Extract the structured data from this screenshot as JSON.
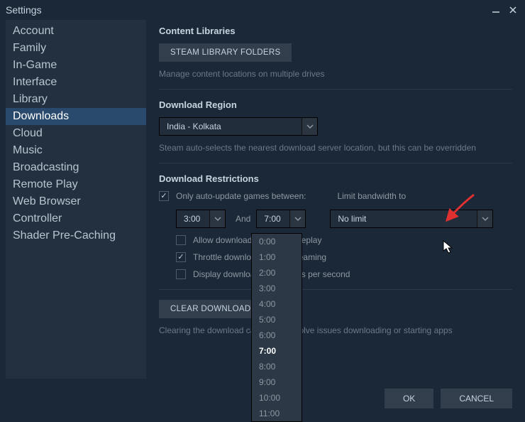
{
  "window": {
    "title": "Settings"
  },
  "sidebar": {
    "items": [
      {
        "label": "Account"
      },
      {
        "label": "Family"
      },
      {
        "label": "In-Game"
      },
      {
        "label": "Interface"
      },
      {
        "label": "Library"
      },
      {
        "label": "Downloads"
      },
      {
        "label": "Cloud"
      },
      {
        "label": "Music"
      },
      {
        "label": "Broadcasting"
      },
      {
        "label": "Remote Play"
      },
      {
        "label": "Web Browser"
      },
      {
        "label": "Controller"
      },
      {
        "label": "Shader Pre-Caching"
      }
    ],
    "active_index": 5
  },
  "content": {
    "libraries": {
      "title": "Content Libraries",
      "button": "STEAM LIBRARY FOLDERS",
      "hint": "Manage content locations on multiple drives"
    },
    "region": {
      "title": "Download Region",
      "value": "India - Kolkata",
      "hint": "Steam auto-selects the nearest download server location, but this can be overridden"
    },
    "restrictions": {
      "title": "Download Restrictions",
      "auto_update": {
        "checked": true,
        "label": "Only auto-update games between:"
      },
      "time_from": "3:00",
      "and": "And",
      "time_to": "7:00",
      "limit_label": "Limit bandwidth to",
      "limit_value": "No limit",
      "allow": {
        "checked": false,
        "label": "Allow downloads during gameplay"
      },
      "throttle": {
        "checked": true,
        "label": "Throttle downloads while streaming"
      },
      "display_rates": {
        "checked": false,
        "label": "Display download rates in bits per second"
      }
    },
    "cache": {
      "button": "CLEAR DOWNLOAD CACHE",
      "hint": "Clearing the download cache can resolve issues downloading or starting apps"
    }
  },
  "dropdown": {
    "options": [
      "0:00",
      "1:00",
      "2:00",
      "3:00",
      "4:00",
      "5:00",
      "6:00",
      "7:00",
      "8:00",
      "9:00",
      "10:00",
      "11:00"
    ],
    "selected": "7:00"
  },
  "footer": {
    "ok": "OK",
    "cancel": "CANCEL"
  }
}
